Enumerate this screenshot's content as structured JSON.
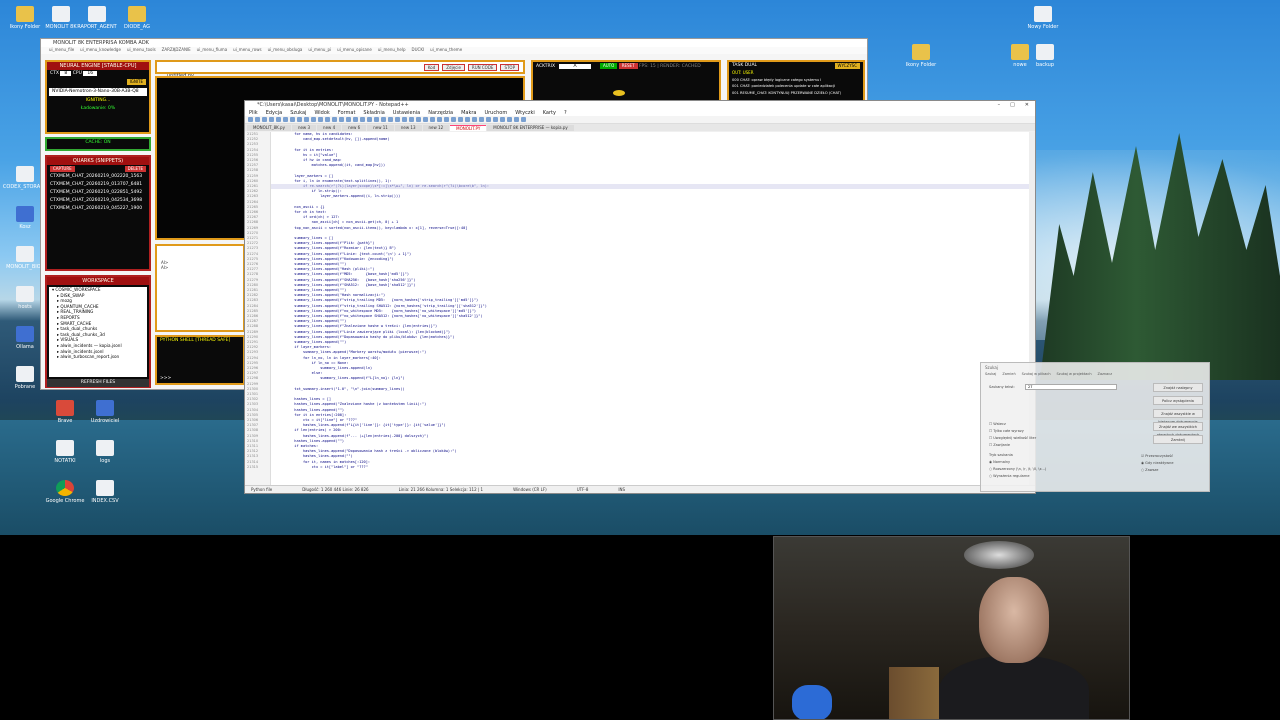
{
  "desktop_icons_left": [
    {
      "label": "Ikony Folder",
      "kind": "folder"
    },
    {
      "label": "MONOLIT 8K",
      "kind": "file"
    },
    {
      "label": "RAPORT_AGENT",
      "kind": "file"
    },
    {
      "label": "DIODE_AG",
      "kind": "folder"
    },
    {
      "label": "CODEX_STORAGE",
      "kind": "file"
    },
    {
      "label": "Kosz",
      "kind": "app"
    },
    {
      "label": "MONOLIT_BIOS",
      "kind": "file"
    },
    {
      "label": "hosts",
      "kind": "file"
    },
    {
      "label": "Ollama",
      "kind": "app"
    },
    {
      "label": "Pobrane",
      "kind": "file"
    },
    {
      "label": "Brave",
      "kind": "red"
    },
    {
      "label": "Uzdrowiciel",
      "kind": "app"
    },
    {
      "label": "NOTATKI",
      "kind": "file"
    },
    {
      "label": "logs",
      "kind": "file"
    },
    {
      "label": "Google Chrome",
      "kind": "chrome"
    },
    {
      "label": "INDEX.CSV",
      "kind": "file"
    }
  ],
  "desktop_icons_right": [
    {
      "label": "Ikony Folder",
      "kind": "folder"
    },
    {
      "label": "nowe",
      "kind": "folder"
    },
    {
      "label": "Nowy Folder",
      "kind": "file"
    },
    {
      "label": "backup",
      "kind": "file"
    }
  ],
  "ide": {
    "title": "MONOLIT 8K ENTERPRISA KOMBA ADK",
    "tabs": [
      "ui_menu_file",
      "ui_menu_knowledge",
      "ui_menu_tools",
      "ZARZĄDZANIE",
      "ui_menu_fiuma",
      "ui_menu_rows",
      "ui_menu_obsluga",
      "ui_menu_pi",
      "ui_menu_opisane",
      "ui_menu_help",
      "DUCKI",
      "ui_menu_theme"
    ],
    "neural_title": "NEURAL ENGINE [STABLE-CPU]",
    "ctx_label": "CTX",
    "ctx_value": "8",
    "cpu_label": "CPU",
    "cpu_value": "16",
    "ignite": "IGNITE",
    "model_name": "NVIDIA-Nemotron-3-Nano-30B-A3B-Q8",
    "igniting": "IGNITING...",
    "loading": "Ładowanie: 0%",
    "cache": "CACHE: ON",
    "quarks_title": "QUARKS (SNIPPETS)",
    "capture": "CAPTURE",
    "delete": "DELETE",
    "snippets": [
      "CTXMEM_CHAT_20260219_002220_1563",
      "CTXMEM_CHAT_20260219_013707_6481",
      "CTXMEM_CHAT_20260219_022851_5492",
      "CTXMEM_CHAT_20260219_042534_3698",
      "CTXMEM_CHAT_20260219_045227_1900"
    ],
    "workspace_title": "WORKSPACE",
    "tree": [
      "COSMIC_WORKSPACE",
      "DISK_SWAP",
      "mozg",
      "QUANTUM_CACHE",
      "REAL_TRAINING",
      "REPORTS",
      "SMART_CACHE",
      "task_dual_chunks",
      "task_dual_chunks_3d",
      "VISUALS",
      "alwin_incidents — kopia.jsonl",
      "alwin_incidents.jsonl",
      "alwin_turboscan_report.json"
    ],
    "refresh": "REFRESH FILES",
    "editor_file": "untitled.py",
    "editor_buttons": [
      "Kod",
      "Zdjęcie",
      "RUN CODE",
      "STOP"
    ],
    "chat_lines": [
      "AI>",
      "AI>"
    ],
    "python_shell": "PYTHON SHELL [THREAD SAFE]",
    "prompt": ">>>",
    "acktrix": "ACKTRIX",
    "auto": "AUTO",
    "reset": "RESET",
    "fps": "FPS: 15 | RENDER: CACHED",
    "task_title": "TASK DUAL",
    "wyczysc": "WYCZYŚĆ",
    "out_user": "OUT: USER",
    "task_lines": [
      "000 CHAT: opraw błędy logiczne całego systemu I",
      "001 CHAT: poniedziałek polecenia update w całe aplikacji",
      "001 RESUME_CHAT: KONTYNUUJ PRZERWANE DZIEŁO (CHAT)"
    ]
  },
  "notepad": {
    "title": "*C:\\Users\\kasai\\Desktop\\MONOLIT\\MONOLIT.PY - Notepad++",
    "menu": [
      "Plik",
      "Edycja",
      "Szukaj",
      "Widok",
      "Format",
      "Składnia",
      "Ustawienia",
      "Narzędzia",
      "Makra",
      "Uruchom",
      "Wtyczki",
      "Karty",
      "?"
    ],
    "tabs": [
      {
        "label": "MONOLIT_8K.py",
        "active": false
      },
      {
        "label": "new 3",
        "active": false
      },
      {
        "label": "new 4",
        "active": false
      },
      {
        "label": "new 6",
        "active": false
      },
      {
        "label": "new 11",
        "active": false
      },
      {
        "label": "new 13",
        "active": false
      },
      {
        "label": "new 12",
        "active": false
      },
      {
        "label": "MONOLIT.PY",
        "active": true
      },
      {
        "label": "MONOLIT 8K ENTERPRISE — kopia.py",
        "active": false
      }
    ],
    "first_line": 21251,
    "code_lines": [
      "        for name, hv in candidates:",
      "            cand_map.setdefault(hv, []).append(name)",
      "",
      "        for it in entries:",
      "            hv = it[\"value\"]",
      "            if hv in cand_map:",
      "                matches.append((it, cand_map[hv]))",
      "",
      "        layer_markers = []",
      "        for i, ln in enumerate(text.splitlines(), 1):",
      "            if re.search(r\"(?i)(layer|scope)\\s*[:=]\\s*\\w+\", ln) or re.search(r\"(?i)\\bcore\\b\", ln):",
      "                if ln.strip():",
      "                    layer_markers.append((i, ln.strip()))",
      "",
      "        non_ascii = {}",
      "        for ch in text:",
      "            if ord(ch) > 127:",
      "                non_ascii[ch] = non_ascii.get(ch, 0) + 1",
      "        top_non_ascii = sorted(non_ascii.items(), key=lambda x: x[1], reverse=True)[:40]",
      "",
      "        summary_lines = []",
      "        summary_lines.append(f\"Plik: {path}\")",
      "        summary_lines.append(f\"Rozmiar: {len(text)} B\")",
      "        summary_lines.append(f\"Linie: {text.count('\\n') + 1}\")",
      "        summary_lines.append(f\"Kodowanie: {encoding}\")",
      "        summary_lines.append(\"\")",
      "        summary_lines.append(\"Hash (pliki):\")",
      "        summary_lines.append(f\"MD5:      {base_hash['md5']}\")",
      "        summary_lines.append(f\"SHA256:   {base_hash['sha256']}\")",
      "        summary_lines.append(f\"SHA512:   {base_hash['sha512']}\")",
      "        summary_lines.append(\"\")",
      "        summary_lines.append(\"Hash normalizacji:\")",
      "        summary_lines.append(f\"strip_trailing MD5:   {norm_hashes['strip_trailing']['md5']}\")",
      "        summary_lines.append(f\"strip_trailing SHA512: {norm_hashes['strip_trailing']['sha512']}\")",
      "        summary_lines.append(f\"no_whitespace MD5:    {norm_hashes['no_whitespace']['md5']}\")",
      "        summary_lines.append(f\"no_whitespace SHA512: {norm_hashes['no_whitespace']['sha512']}\")",
      "        summary_lines.append(\"\")",
      "        summary_lines.append(f\"Znalezione hashe w treści: {len(entries)}\")",
      "        summary_lines.append(f\"Linie zawierające pliki (local): {len(blocked)}\")",
      "        summary_lines.append(f\"Dopasowania hashy do pliku/bloków: {len(matches)}\")",
      "        summary_lines.append(\"\")",
      "        if layer_markers:",
      "            summary_lines.append(\"Markery warstw/modułu (pierwsze):\")",
      "            for ln_no, ln in layer_markers[:40]:",
      "                if ln_no == None:",
      "                    summary_lines.append(ln)",
      "                else:",
      "                    summary_lines.append(f\"L{ln_no}: {ln}\")",
      "",
      "        txt_summary.insert(\"1.0\", \"\\n\".join(summary_lines))",
      "",
      "        hashes_lines = []",
      "        hashes_lines.append(\"Znalezione hashe (z kontekstem linii):\")",
      "        hashes_lines.append(\"\")",
      "        for it in entries[:200]:",
      "            ctx = it[\"line\"] or \"???\"",
      "            hashes_lines.append(f\"L{it['line']}: {it['type']}: {it['value']}\")",
      "        if len(entries) > 200:",
      "            hashes_lines.append(f\"... (+{len(entries)-200} dalszych)\")",
      "        hashes_lines.append(\"\")",
      "        if matches:",
      "            hashes_lines.append(\"Dopasowania hash z treści -> obliczone (bloków):\")",
      "            hashes_lines.append(\"\")",
      "            for it, names in matches[:120]:",
      "                ctx = it[\"label\"] or \"???\""
    ],
    "status": [
      "Python file",
      "Długość: 1 260 446   Linie: 26 826",
      "Linia: 21 266   Kolumna: 1   Selekcja: 112 | 1",
      "Windows (CR LF)",
      "UTF-8",
      "INS"
    ]
  },
  "dialog": {
    "title": "Szukaj",
    "tabs": [
      "Szukaj",
      "Zamień",
      "Szukaj w plikach",
      "Szukaj w projektach",
      "Zaznacz"
    ],
    "find_label": "Szukany tekst:",
    "find_value": "27",
    "buttons": [
      "Znajdź następny",
      "Policz wystąpienia",
      "Znajdź wszystkie w bieżącym dokumencie",
      "Znajdź we wszystkich otwartych dokumentach",
      "Zamknij"
    ],
    "options": [
      "Wstecz",
      "Tylko całe wyrazy",
      "Uwzględnij wielkość liter",
      "Zawijanie"
    ],
    "mode_title": "Tryb szukania",
    "modes": [
      "Normalny",
      "Rozszerzony (\\n, \\r, \\t, \\0, \\x...)",
      "Wyrażenia regularne"
    ],
    "transparency": [
      "Przezroczystość",
      "Gdy nieaktywne",
      "Zawsze"
    ]
  }
}
